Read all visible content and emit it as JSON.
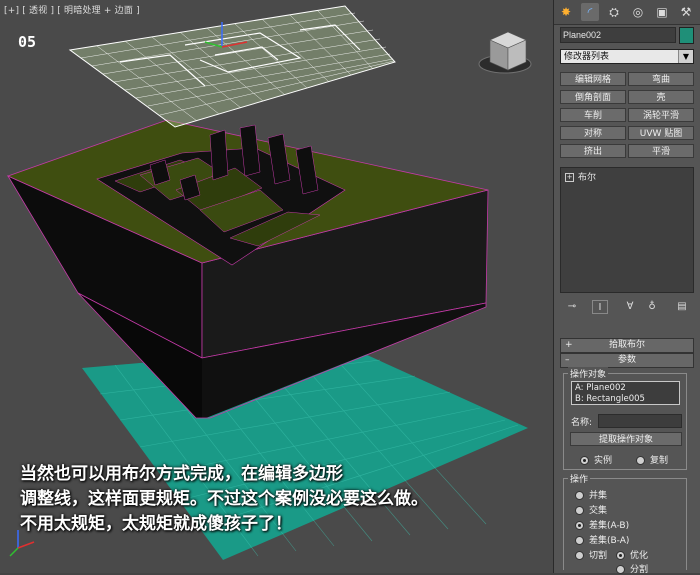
{
  "viewport": {
    "label": "[+] [ 透视 ] [ 明暗处理 + 边面 ]",
    "step": "05",
    "caption_lines": [
      "当然也可以用布尔方式完成，在编辑多边形",
      "调整线，这样面更规矩。不过这个案例没必要这么做。",
      "不用太规矩，太规矩就成傻孩子了！"
    ]
  },
  "panel": {
    "object_name": "Plane002",
    "object_color": "#1f8f78",
    "modifier_list": "修改器列表",
    "modifier_buttons": [
      "编辑网格",
      "弯曲",
      "倒角剖面",
      "壳",
      "车削",
      "涡轮平滑",
      "对称",
      "UVW 贴图",
      "挤出",
      "平滑"
    ],
    "stack_items": [
      "布尔"
    ],
    "rollouts": {
      "pick": "拾取布尔",
      "params": "参数"
    },
    "operands": {
      "title": "操作对象",
      "items": [
        "A: Plane002",
        "B: Rectangle005"
      ],
      "name_label": "名称:",
      "extract_button": "提取操作对象",
      "instance": "实例",
      "copy": "复制"
    },
    "operation": {
      "title": "操作",
      "options": [
        "并集",
        "交集",
        "差集(A-B)",
        "差集(B-A)"
      ],
      "selected": "差集(A-B)",
      "cut": "切割",
      "refine": "优化",
      "split": "分割"
    }
  }
}
